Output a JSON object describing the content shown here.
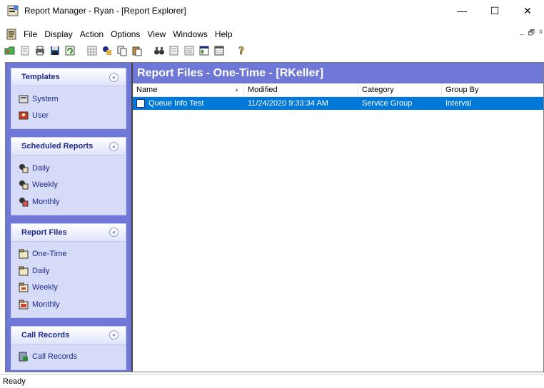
{
  "window": {
    "title": "Report Manager - Ryan - [Report Explorer]",
    "minimize": "—",
    "maximize": "☐",
    "close": "✕"
  },
  "menu": {
    "items": [
      "File",
      "Display",
      "Action",
      "Options",
      "View",
      "Windows",
      "Help"
    ],
    "mdi_minimize": "_",
    "mdi_restore": "🗗",
    "mdi_close": "x"
  },
  "toolbar": {
    "icons": [
      "open-icon",
      "new-icon",
      "print-icon",
      "save-icon",
      "refresh-icon",
      "grid-icon",
      "schedule-icon",
      "copy-icon",
      "paste-icon",
      "binoculars-icon",
      "report-icon",
      "report-list-icon",
      "properties-icon",
      "table-icon",
      "help-icon"
    ]
  },
  "sidebar": {
    "groups": [
      {
        "title": "Templates",
        "items": [
          "System",
          "User"
        ]
      },
      {
        "title": "Scheduled Reports",
        "items": [
          "Daily",
          "Weekly",
          "Monthly"
        ]
      },
      {
        "title": "Report Files",
        "items": [
          "One-Time",
          "Daily",
          "Weekly",
          "Monthly"
        ]
      },
      {
        "title": "Call Records",
        "items": [
          "Call Records"
        ]
      }
    ],
    "collapse_glyph": "«"
  },
  "content": {
    "header": "Report Files - One-Time - [RKeller]",
    "columns": [
      "Name",
      "Modified",
      "Category",
      "Group By"
    ],
    "sort_glyph": "▲",
    "rows": [
      {
        "name": "Queue Info Test",
        "modified": "11/24/2020 9:33:34 AM",
        "category": "Service Group",
        "group_by": "Interval"
      }
    ]
  },
  "status": "Ready",
  "colors": {
    "sidebar_bg": "#6f78d6",
    "group_bg": "#d6dcf8",
    "selection": "#0078d7",
    "header_text": "#1d2a8a"
  }
}
